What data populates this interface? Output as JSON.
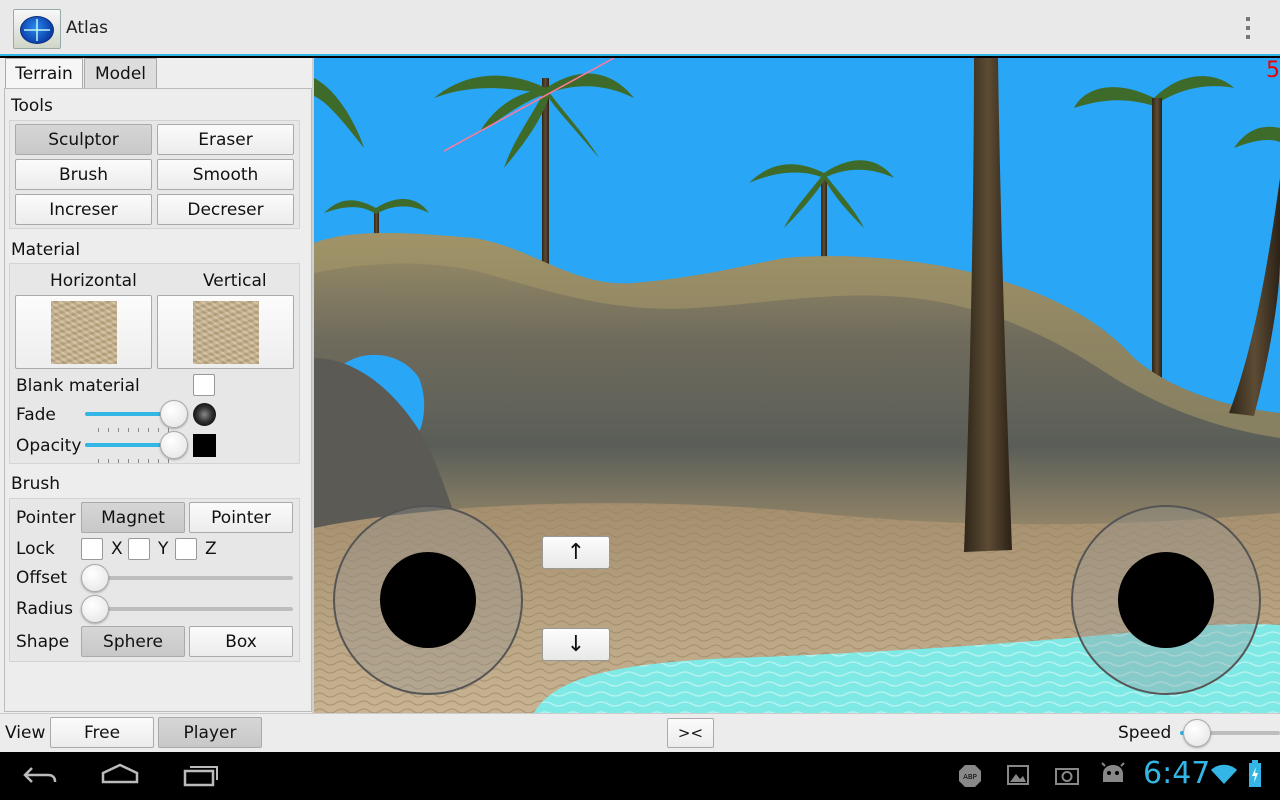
{
  "app": {
    "title": "Atlas",
    "icon": "globe-icon"
  },
  "tabs": [
    {
      "label": "Terrain",
      "selected": true
    },
    {
      "label": "Model",
      "selected": false
    }
  ],
  "tools": {
    "title": "Tools",
    "buttons": [
      {
        "label": "Sculptor",
        "selected": true
      },
      {
        "label": "Eraser",
        "selected": false
      },
      {
        "label": "Brush",
        "selected": false
      },
      {
        "label": "Smooth",
        "selected": false
      },
      {
        "label": "Increser",
        "selected": false
      },
      {
        "label": "Decreser",
        "selected": false
      }
    ]
  },
  "material": {
    "title": "Material",
    "horizontal_label": "Horizontal",
    "vertical_label": "Vertical",
    "blank_label": "Blank material",
    "blank_checked": false,
    "fade_label": "Fade",
    "fade_value": 0.85,
    "opacity_label": "Opacity",
    "opacity_value": 0.85
  },
  "brush": {
    "title": "Brush",
    "pointer_label": "Pointer",
    "pointer_options": [
      {
        "label": "Magnet",
        "selected": true
      },
      {
        "label": "Pointer",
        "selected": false
      }
    ],
    "lock_label": "Lock",
    "lock_axes": [
      {
        "label": "X",
        "checked": false
      },
      {
        "label": "Y",
        "checked": false
      },
      {
        "label": "Z",
        "checked": false
      }
    ],
    "offset_label": "Offset",
    "offset_value": 0,
    "radius_label": "Radius",
    "radius_value": 0,
    "shape_label": "Shape",
    "shape_options": [
      {
        "label": "Sphere",
        "selected": true
      },
      {
        "label": "Box",
        "selected": false
      }
    ]
  },
  "viewport": {
    "fps_text": "5",
    "up_label": "↑",
    "down_label": "↓"
  },
  "bottom": {
    "view_label": "View",
    "view_options": [
      {
        "label": "Free",
        "selected": false
      },
      {
        "label": "Player",
        "selected": true
      }
    ],
    "center_label": "><",
    "speed_label": "Speed",
    "speed_value": 0.05
  },
  "status": {
    "time": "6:47"
  },
  "colors": {
    "accent": "#33b5e5",
    "sky": "#29a6f6",
    "water": "#7fe9e6",
    "fps": "#ee0000"
  }
}
